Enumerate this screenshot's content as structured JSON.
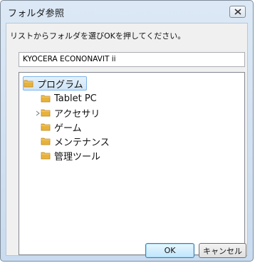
{
  "window": {
    "title": "フォルダ参照"
  },
  "instruction": "リストからフォルダを選びOKを押してください。",
  "path_value": "KYOCERA ECONONAVIT ii",
  "tree": {
    "root": "プログラム",
    "items": [
      {
        "label": "Tablet PC",
        "expandable": false
      },
      {
        "label": "アクセサリ",
        "expandable": true
      },
      {
        "label": "ゲーム",
        "expandable": false
      },
      {
        "label": "メンテナンス",
        "expandable": false
      },
      {
        "label": "管理ツール",
        "expandable": false
      }
    ]
  },
  "buttons": {
    "ok": "OK",
    "cancel": "キャンセル"
  },
  "icons": {
    "folder": "folder-icon",
    "close": "close-icon",
    "expander": "chevron-right-icon"
  },
  "colors": {
    "window_frame": "#c9dbef",
    "client_bg": "#f0f0f0",
    "tree_selection": "#cfe5f7",
    "folder": "#e8b23a"
  }
}
